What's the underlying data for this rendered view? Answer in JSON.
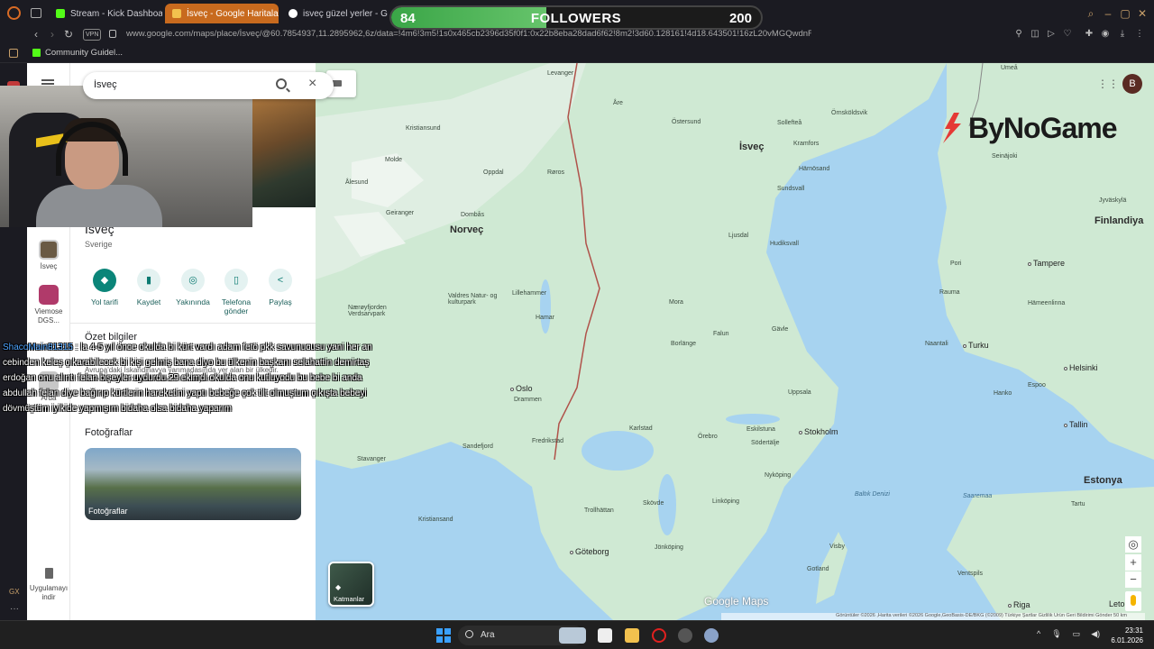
{
  "browser": {
    "tabs": [
      {
        "label": "Stream - Kick Dashboard",
        "fav": "#53fc18"
      },
      {
        "label": "İsveç - Google Haritalar",
        "fav": "#f2c14e"
      },
      {
        "label": "isveç güzel yerler - Goog",
        "fav": "#ffffff"
      }
    ],
    "vpn": "VPN",
    "url": "www.google.com/maps/place/İsveç/@60.7854937,11.2895962,6z/data=!4m6!3m5!1s0x465cb2396d35f0f1:0x22b8eba28dad6f62!8m2!3d60.128161!4d18.643501!16zL20vMGQwdnFu",
    "bookmark": "Community Guidel..."
  },
  "followers_widget": {
    "count": "84",
    "label": "FOLLOWERS",
    "goal": "200",
    "progress": 0.42
  },
  "maps_panel": {
    "search_value": "İsveç",
    "place_title": "İsveç",
    "place_subtitle": "Sverige",
    "rail": [
      {
        "label": "İsveç",
        "color": "#6a5a44"
      },
      {
        "label": "Viemose DGS...",
        "color": "#b03a6a"
      },
      {
        "label": "Arda",
        "color": "#c7c7c7"
      }
    ],
    "actions": [
      {
        "label": "Yol tarifi",
        "icon": "◆"
      },
      {
        "label": "Kaydet",
        "icon": "▮"
      },
      {
        "label": "Yakınında",
        "icon": "◎"
      },
      {
        "label": "Telefona gönder",
        "icon": "▯"
      },
      {
        "label": "Paylaş",
        "icon": "<"
      }
    ],
    "overview_title": "Özet bilgiler",
    "overview_text": "Avrupa'daki İskandinavya yarımadasında yer alan bir ülkedir. Ülkenin sınır komşuları batı ve kuzeyden No...",
    "photos_title": "Fotoğraflar",
    "photo_card_label": "Fotoğraflar",
    "uninstall": "Uygulamayı indir"
  },
  "map": {
    "layers_label": "Katmanlar",
    "logo": "Google Maps",
    "attribution": "Görüntüler ©2026 ,Harita verileri ©2026 Google,GeoBasis-DE/BKG (©2009)   Türkiye   Şartlar   Gizlilik   Ürün Geri Bildirimi Gönder   50 km",
    "countries": [
      "İsveç",
      "Norveç",
      "Finlandiya",
      "Estonya"
    ],
    "cities": [
      "Oslo",
      "Stokholm",
      "Göteborg",
      "Helsinki",
      "Turku",
      "Tampere",
      "Tallin",
      "Riga",
      "Letony"
    ],
    "towns": [
      "Levanger",
      "Åre",
      "Östersund",
      "Sollefteå",
      "Örnsköldsvik",
      "Umeå",
      "Kristiansund",
      "Molde",
      "Ålesund",
      "Oppdal",
      "Røros",
      "Kramfors",
      "Härnösand",
      "Sundsvall",
      "Geiranger",
      "Dombås",
      "Ljusdal",
      "Hudiksvall",
      "Nærøyfjorden Verdsarvpark",
      "Valdres Natur- og kulturpark",
      "Lillehammer",
      "Hamar",
      "Mora",
      "Falun",
      "Gävle",
      "Borlänge",
      "Uppsala",
      "Drammen",
      "Karlstad",
      "Örebro",
      "Eskilstuna",
      "Södertälje",
      "Sandefjord",
      "Stavanger",
      "Fredrikstad",
      "Nyköping",
      "Linköping",
      "Kristiansand",
      "Skövde",
      "Trollhättan",
      "Jönköping",
      "Visby",
      "Gotland",
      "Ventspils",
      "Pori",
      "Rauma",
      "Naantali",
      "Espoo",
      "Hanko",
      "Hämeenlinna",
      "Seinäjoki",
      "Jyväskylä",
      "Tartu"
    ],
    "seas": [
      "Baltık Denizi",
      "Saaremaa"
    ]
  },
  "brand_overlay": "ByNoGame",
  "chat": {
    "user": "ShacoMain81315",
    "message": "la 4-5 yıl önce okulda bi kürt vardı adam fetö pkk savunucusu yani her an cebinden keleş çıkarabilecek bi kişi gelmiş bana diyo bu ülkenin başkanı selahattin demirtaş erdoğan onu alıntı felan bişeyler uydurdu 29 ekimdi okulda onu kutluyodu bu bebe bi anda abdullah felan diye bağırıp kürtlerin hareketini yaptı bebeğe çok tilt olmuştum çıkışta bebeyi dövmüştüm iyikide yapmışım bidaha olsa bidaha yaparım"
  },
  "taskbar": {
    "search_label": "Ara",
    "time": "23:31",
    "date": "6.01.2026"
  },
  "opera": {
    "gx_label": "GX",
    "dots": "···"
  }
}
